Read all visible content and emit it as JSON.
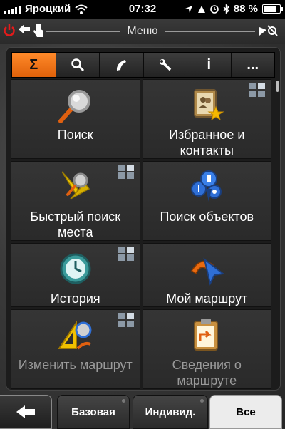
{
  "status_bar": {
    "carrier": "Яроцкий",
    "time": "07:32",
    "battery_percent": "88 %"
  },
  "title_bar": {
    "title": "Меню"
  },
  "tabs": [
    {
      "icon": "sigma-icon",
      "glyph": "Σ",
      "active": true
    },
    {
      "icon": "search-icon",
      "glyph": "",
      "active": false
    },
    {
      "icon": "phone-icon",
      "glyph": "",
      "active": false
    },
    {
      "icon": "wrench-icon",
      "glyph": "",
      "active": false
    },
    {
      "icon": "info-icon",
      "glyph": "i",
      "active": false
    },
    {
      "icon": "more-icon",
      "glyph": "...",
      "active": false
    }
  ],
  "tiles": [
    {
      "label": "Поиск",
      "icon": "magnifier-icon",
      "has_mini": false
    },
    {
      "label": "Избранное и контакты",
      "icon": "address-book-icon",
      "has_mini": true
    },
    {
      "label": "Быстрый поиск места",
      "icon": "quick-search-icon",
      "has_mini": true
    },
    {
      "label": "Поиск объектов",
      "icon": "poi-icon",
      "has_mini": false
    },
    {
      "label": "История",
      "icon": "history-icon",
      "has_mini": true
    },
    {
      "label": "Мой маршрут",
      "icon": "route-icon",
      "has_mini": false
    },
    {
      "label": "Изменить маршрут",
      "icon": "edit-route-icon",
      "has_mini": true
    },
    {
      "label": "Сведения о маршруте",
      "icon": "route-info-icon",
      "has_mini": false
    }
  ],
  "bottom_bar": {
    "tab_basic": "Базовая",
    "tab_custom": "Индивид.",
    "tab_all": "Все",
    "active_tab": "Все"
  },
  "colors": {
    "accent": "#f07a1a",
    "tile": "#2e2e2e",
    "panel": "#1c1c1c"
  }
}
